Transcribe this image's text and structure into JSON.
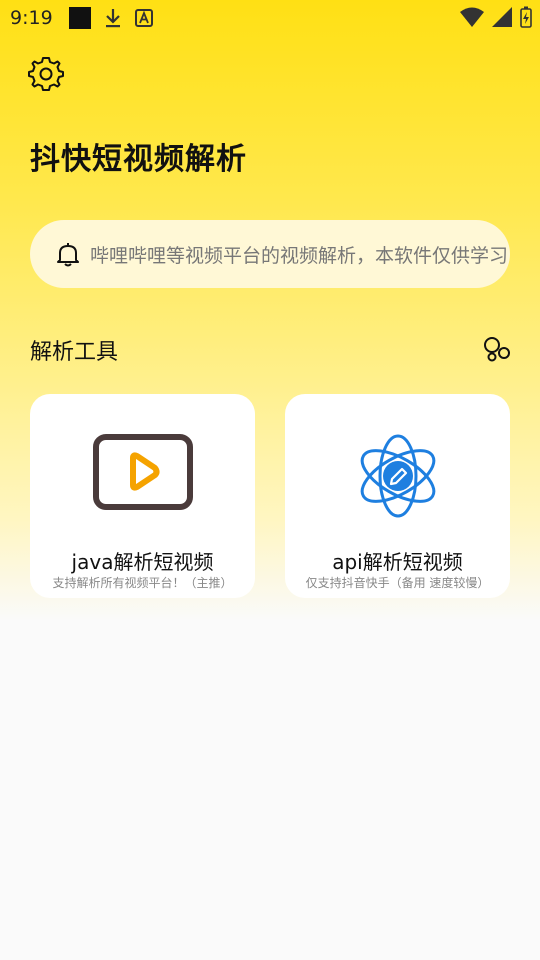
{
  "status_bar": {
    "time": "9:19",
    "icons": [
      "notification-square-icon",
      "download-icon",
      "font-a-icon",
      "wifi-icon",
      "signal-icon",
      "battery-charging-icon"
    ]
  },
  "header": {
    "settings_icon": "gear-icon",
    "title": "抖快短视频解析"
  },
  "notice": {
    "icon": "bell-icon",
    "text": "哔哩哔哩等视频平台的视频解析，本软件仅供学习"
  },
  "section": {
    "title": "解析工具",
    "more_icon": "bubbles-icon"
  },
  "cards": [
    {
      "title": "java解析短视频",
      "subtitle": "支持解析所有视频平台！（主推）",
      "icon": "video-play-icon",
      "icon_frame_color": "#4A3B3B",
      "icon_accent_color": "#F5A300"
    },
    {
      "title": "api解析短视频",
      "subtitle": "仅支持抖音快手（备用 速度较慢）",
      "icon": "atom-pencil-icon",
      "icon_color": "#1E7FE0"
    }
  ],
  "colors": {
    "brand_yellow": "#FFE014",
    "background": "#FAFAFA"
  }
}
